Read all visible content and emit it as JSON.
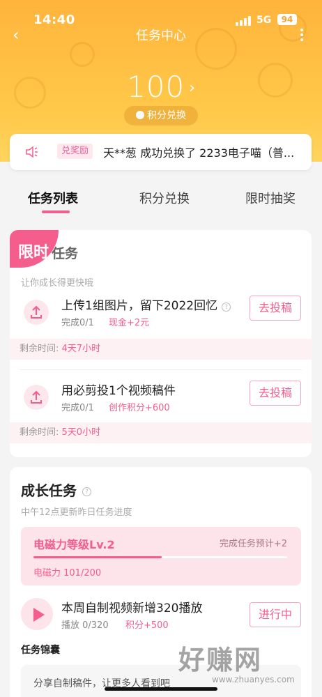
{
  "status_bar": {
    "time": "14:40",
    "network": "5G",
    "battery": "94"
  },
  "nav": {
    "title": "任务中心"
  },
  "points": {
    "value": "100",
    "exchange_label": "积分兑换"
  },
  "notice": {
    "badge": "兑奖励",
    "text": "天**葱 成功兑换了 2233电子喵（普..."
  },
  "tabs": [
    {
      "label": "任务列表",
      "active": true
    },
    {
      "label": "积分兑换",
      "active": false
    },
    {
      "label": "限时抽奖",
      "active": false
    }
  ],
  "limited": {
    "badge": "限时",
    "title": "任务",
    "subtitle": "让你成长得更快哦",
    "tasks": [
      {
        "title": "上传1组图片，留下2022回忆",
        "progress": "完成0/1",
        "reward": "现金+2元",
        "button": "去投稿",
        "remain_label": "剩余时间:",
        "remain_value": "4天7小时"
      },
      {
        "title": "用必剪投1个视频稿件",
        "progress": "完成0/1",
        "reward": "创作积分+600",
        "button": "去投稿",
        "remain_label": "剩余时间:",
        "remain_value": "5天0小时"
      }
    ]
  },
  "growth": {
    "title": "成长任务",
    "subtitle": "中午12点更新昨日任务进度",
    "level": {
      "name": "电磁力等级Lv.2",
      "estimate": "完成任务预计+2",
      "value_text": "电磁力 101/200",
      "progress_fraction": 0.505
    },
    "task": {
      "title": "本周自制视频新增320播放",
      "progress": "播放 0/320",
      "reward": "积分+500",
      "button": "进行中"
    },
    "pocket_title": "任务锦囊",
    "pocket_text": "分享自制稿件，让更多人看到吧"
  },
  "watermark": {
    "big": "好赚网",
    "small": "www.zhuanyes.com"
  },
  "colors": {
    "accent": "#f45d8c",
    "header": "#ffb43c"
  }
}
